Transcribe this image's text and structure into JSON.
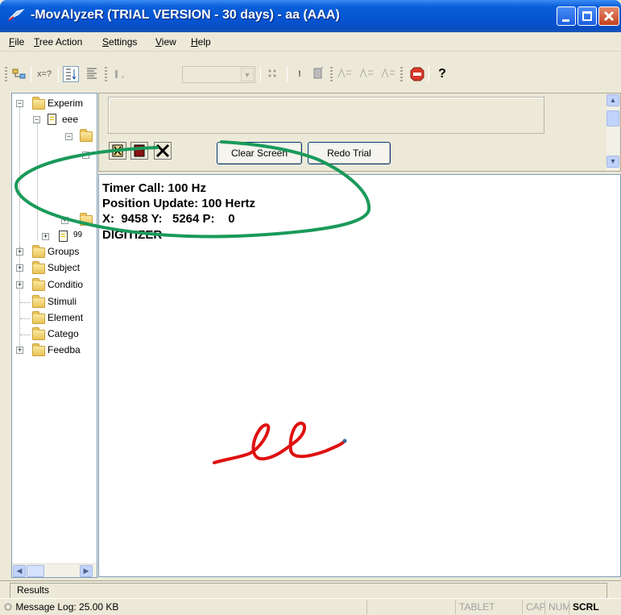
{
  "window": {
    "title": "-MovAlyzeR (TRIAL VERSION - 30 days) - aa (AAA)"
  },
  "menu": {
    "items": [
      "File",
      "Tree Action",
      "Settings",
      "View",
      "Help"
    ]
  },
  "toolbar": {
    "xeq_label": "x=?"
  },
  "tree": {
    "items": [
      {
        "label": "Experim",
        "expander": "−",
        "icon": "folder"
      },
      {
        "label": "eee",
        "expander": "−",
        "icon": "document"
      },
      {
        "label": "",
        "expander": "−",
        "icon": "folder"
      },
      {
        "label": "",
        "expander": "−",
        "icon": "folder"
      },
      {
        "label": "",
        "expander": "+",
        "icon": "folder"
      },
      {
        "label": "99",
        "expander": "+",
        "icon": "document"
      },
      {
        "label": "Groups",
        "expander": "+",
        "icon": "folder"
      },
      {
        "label": "Subject",
        "expander": "+",
        "icon": "folder"
      },
      {
        "label": "Conditio",
        "expander": "+",
        "icon": "folder"
      },
      {
        "label": "Stimuli",
        "expander": "",
        "icon": "folder"
      },
      {
        "label": "Element",
        "expander": "",
        "icon": "folder"
      },
      {
        "label": "Catego",
        "expander": "",
        "icon": "folder"
      },
      {
        "label": "Feedba",
        "expander": "+",
        "icon": "folder"
      }
    ]
  },
  "panel": {
    "clear_screen_label": "Clear Screen",
    "redo_trial_label": "Redo Trial"
  },
  "canvas": {
    "timer_call": "Timer Call: 100 Hz",
    "position_update": "Position Update: 100 Hertz",
    "coords": "X:  9458 Y:   5264 P:    0",
    "device": "DIGITIZER",
    "annotation_color": "#1a9a5a",
    "ink_color": "#e01010"
  },
  "results": {
    "tab_label": "Results"
  },
  "status": {
    "message_log": "Message Log: 25.00 KB",
    "tablet": "TABLET",
    "cap": "CAP",
    "num": "NUM",
    "scrl": "SCRL"
  }
}
